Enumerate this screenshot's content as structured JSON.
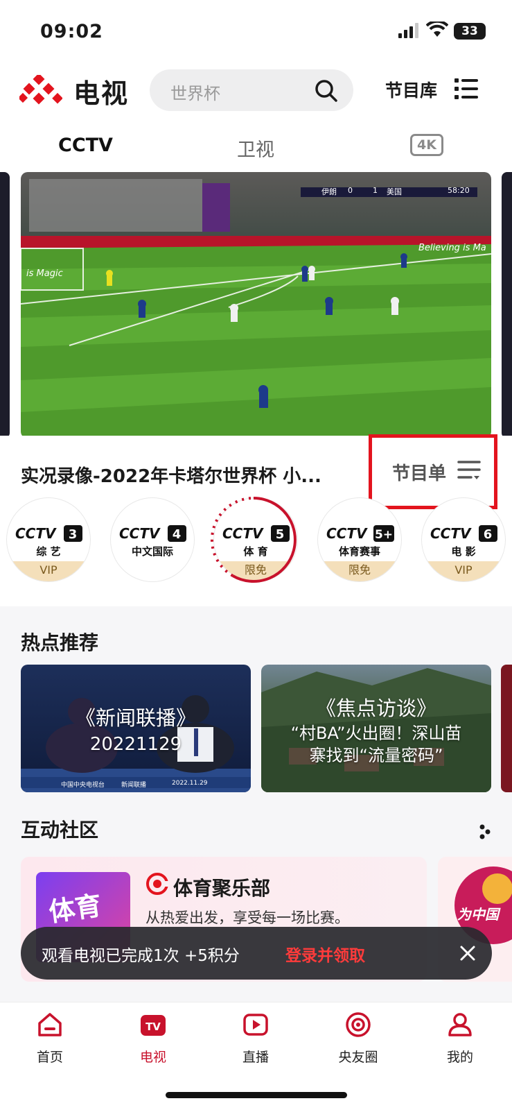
{
  "status_bar": {
    "time": "09:02",
    "battery": "33"
  },
  "header": {
    "title": "电视",
    "search_placeholder": "世界杯",
    "library_label": "节目库"
  },
  "tabs": [
    {
      "label": "CCTV",
      "active": true
    },
    {
      "label": "卫视",
      "active": false
    },
    {
      "label": "4K",
      "active": false
    }
  ],
  "player": {
    "scoreboard": {
      "home": "伊朗",
      "home_score": "0",
      "away_score": "1",
      "away": "美国",
      "clock": "58:20"
    },
    "ad_text_left": "is Magic",
    "ad_text_right": "Believing is Ma"
  },
  "now_playing": {
    "title": "实况录像-2022年卡塔尔世界杯 小...",
    "schedule_label": "节目单"
  },
  "channels": [
    {
      "logo": "CCTV",
      "number": "3",
      "name": "综 艺",
      "badge": "VIP",
      "selected": false
    },
    {
      "logo": "CCTV",
      "number": "4",
      "name": "中文国际",
      "badge": "",
      "selected": false
    },
    {
      "logo": "CCTV",
      "number": "5",
      "name": "体 育",
      "badge": "限免",
      "selected": true
    },
    {
      "logo": "CCTV",
      "number": "5+",
      "name": "体育赛事",
      "badge": "限免",
      "selected": false
    },
    {
      "logo": "CCTV",
      "number": "6",
      "name": "电 影",
      "badge": "VIP",
      "selected": false
    }
  ],
  "hot": {
    "title": "热点推荐",
    "cards": [
      {
        "title": "《新闻联播》",
        "subtitle": "20221129",
        "footer_left": "中国中央电视台",
        "footer_mid": "新闻联播",
        "footer_right": "2022.11.29"
      },
      {
        "title": "《焦点访谈》",
        "line1": "“村BA”火出圈！深山苗",
        "line2": "寨找到“流量密码”"
      }
    ]
  },
  "community": {
    "title": "互动社区",
    "card": {
      "thumb_text": "体育",
      "title": "体育聚乐部",
      "desc": "从热爱出发，享受每一场比赛。"
    },
    "card2_text": "为中国"
  },
  "toast": {
    "message": "观看电视已完成1次 +5积分",
    "action": "登录并领取"
  },
  "nav": [
    {
      "label": "首页",
      "active": false
    },
    {
      "label": "电视",
      "active": true
    },
    {
      "label": "直播",
      "active": false
    },
    {
      "label": "央友圈",
      "active": false
    },
    {
      "label": "我的",
      "active": false
    }
  ],
  "colors": {
    "accent": "#c8122c",
    "highlight": "#e3141e",
    "vip_badge": "#f4dfba"
  }
}
